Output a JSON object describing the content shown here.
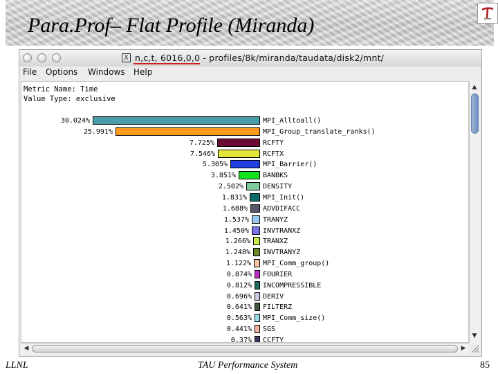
{
  "slide": {
    "title": "Para.Prof– Flat Profile (Miranda)",
    "footer_left": "LLNL",
    "footer_center": "TAU Performance System",
    "page_number": "85"
  },
  "window": {
    "title": "n,c,t, 6016,0,0 - profiles/8k/miranda/taudata/disk2/mnt/",
    "icon": "X",
    "menu": [
      "File",
      "Options",
      "Windows",
      "Help"
    ]
  },
  "profile": {
    "metric_line": "Metric Name: Time",
    "value_type_line": "Value Type: exclusive",
    "rows": [
      {
        "pct": "30.024%",
        "value": 30.024,
        "name": "MPI_Alltoall()",
        "color": "#4a9eac"
      },
      {
        "pct": "25.991%",
        "value": 25.991,
        "name": "MPI_Group_translate_ranks()",
        "color": "#ff9a1a"
      },
      {
        "pct": "7.725%",
        "value": 7.725,
        "name": "RCFTY",
        "color": "#6b0a33"
      },
      {
        "pct": "7.546%",
        "value": 7.546,
        "name": "RCFTX",
        "color": "#e4e63a"
      },
      {
        "pct": "5.305%",
        "value": 5.305,
        "name": "MPI_Barrier()",
        "color": "#1f3fe0"
      },
      {
        "pct": "3.851%",
        "value": 3.851,
        "name": "BANBKS",
        "color": "#16e01f"
      },
      {
        "pct": "2.502%",
        "value": 2.502,
        "name": "DENSITY",
        "color": "#7cc99a"
      },
      {
        "pct": "1.831%",
        "value": 1.831,
        "name": "MPI_Init()",
        "color": "#0e6a6a"
      },
      {
        "pct": "1.688%",
        "value": 1.688,
        "name": "ADVDIFACC",
        "color": "#55596a"
      },
      {
        "pct": "1.537%",
        "value": 1.537,
        "name": "TRANYZ",
        "color": "#9ac8ee"
      },
      {
        "pct": "1.450%",
        "value": 1.45,
        "name": "INVTRANXZ",
        "color": "#7b74e6"
      },
      {
        "pct": "1.266%",
        "value": 1.266,
        "name": "TRANXZ",
        "color": "#c8f04c"
      },
      {
        "pct": "1.248%",
        "value": 1.248,
        "name": "INVTRANYZ",
        "color": "#6b8a2a"
      },
      {
        "pct": "1.122%",
        "value": 1.122,
        "name": "MPI_Comm_group()",
        "color": "#f4c4a4"
      },
      {
        "pct": "0.874%",
        "value": 0.874,
        "name": "FOURIER",
        "color": "#c02cc8"
      },
      {
        "pct": "0.812%",
        "value": 0.812,
        "name": "INCOMPRESSIBLE",
        "color": "#1f6a5a"
      },
      {
        "pct": "0.696%",
        "value": 0.696,
        "name": "DERIV",
        "color": "#c8cce8"
      },
      {
        "pct": "0.641%",
        "value": 0.641,
        "name": "FILTERZ",
        "color": "#3e5a3a"
      },
      {
        "pct": "0.563%",
        "value": 0.563,
        "name": "MPI_Comm_size()",
        "color": "#9adcea"
      },
      {
        "pct": "0.441%",
        "value": 0.441,
        "name": "SGS",
        "color": "#f0b4a0"
      },
      {
        "pct": "0.37%",
        "value": 0.37,
        "name": "CCFTY",
        "color": "#3a3a5a"
      }
    ]
  }
}
